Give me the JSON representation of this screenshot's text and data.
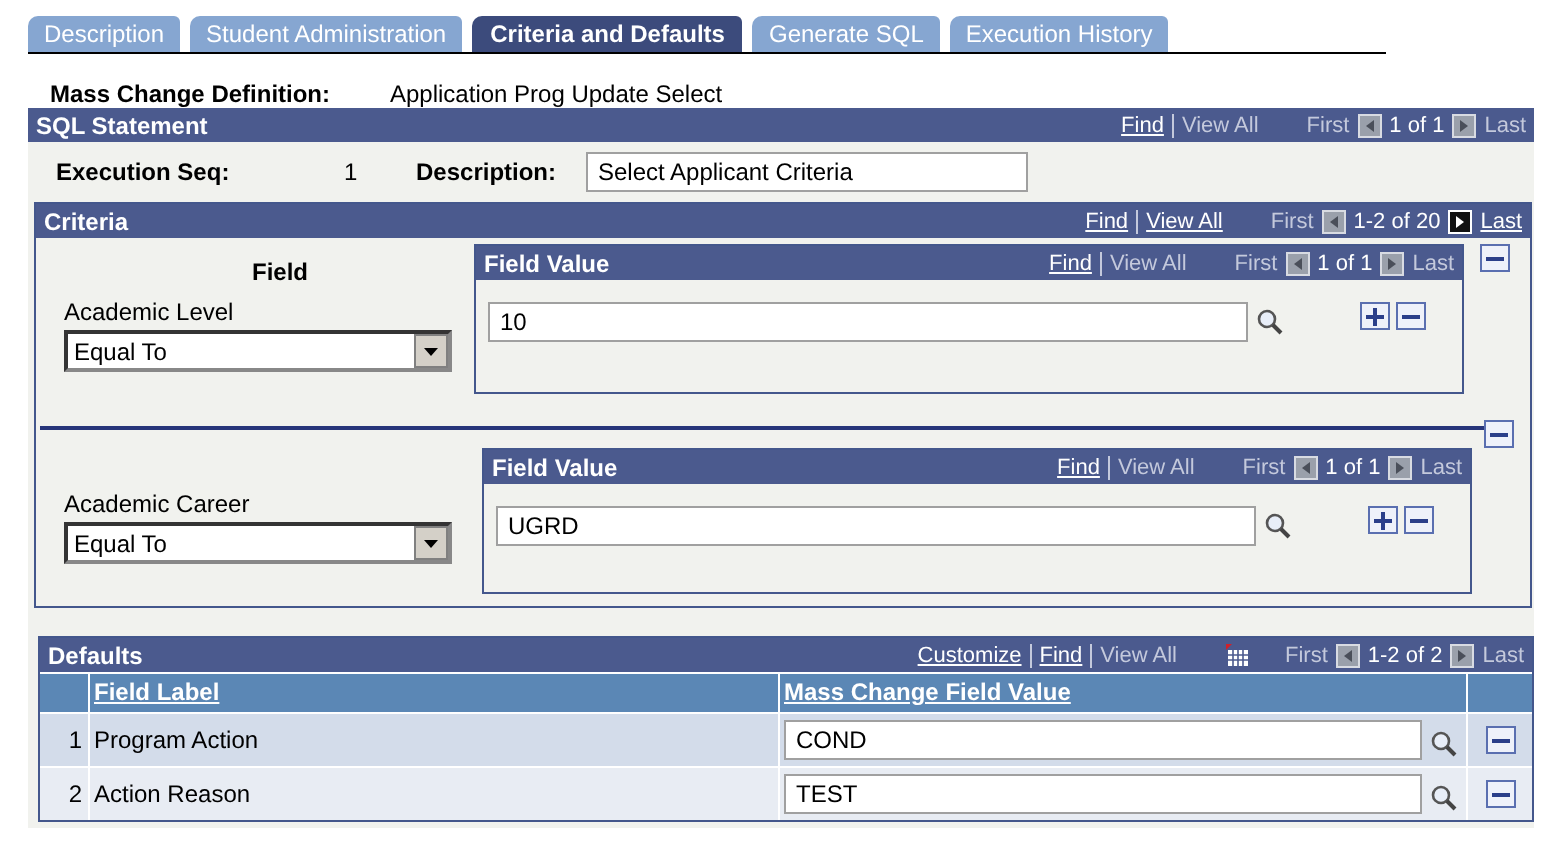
{
  "tabs": [
    {
      "label": "Description",
      "selected": false
    },
    {
      "label": "Student Administration",
      "selected": false
    },
    {
      "label": "Criteria and Defaults",
      "selected": true
    },
    {
      "label": "Generate SQL",
      "selected": false
    },
    {
      "label": "Execution History",
      "selected": false
    }
  ],
  "definition": {
    "label": "Mass Change Definition:",
    "value": "Application Prog Update Select"
  },
  "sql_statement": {
    "title": "SQL Statement",
    "nav": {
      "links": [
        {
          "label": "Find",
          "enabled": true
        },
        {
          "label": "View All",
          "enabled": false
        }
      ],
      "first": {
        "label": "First",
        "enabled": false
      },
      "prev_enabled": false,
      "count": "1 of 1",
      "next_enabled": false,
      "last": {
        "label": "Last",
        "enabled": false
      }
    },
    "seq_label": "Execution Seq:",
    "seq": "1",
    "description_label": "Description:",
    "description": "Select Applicant Criteria"
  },
  "criteria": {
    "title": "Criteria",
    "nav": {
      "links": [
        {
          "label": "Find",
          "enabled": true
        },
        {
          "label": "View All",
          "enabled": true
        }
      ],
      "first": {
        "label": "First",
        "enabled": false
      },
      "prev_enabled": false,
      "count": "1-2 of 20",
      "next_enabled": true,
      "last": {
        "label": "Last",
        "enabled": true
      }
    },
    "rows": [
      {
        "heading": "Field",
        "field": "Academic Level",
        "operator": "Equal To",
        "value_title": "Field Value",
        "nav": {
          "links": [
            {
              "label": "Find",
              "enabled": true
            },
            {
              "label": "View All",
              "enabled": false
            }
          ],
          "first": {
            "label": "First",
            "enabled": false
          },
          "prev_enabled": false,
          "count": "1 of 1",
          "next_enabled": false,
          "last": {
            "label": "Last",
            "enabled": false
          }
        },
        "value": "10"
      },
      {
        "field": "Academic Career",
        "operator": "Equal To",
        "value_title": "Field Value",
        "nav": {
          "links": [
            {
              "label": "Find",
              "enabled": true
            },
            {
              "label": "View All",
              "enabled": false
            }
          ],
          "first": {
            "label": "First",
            "enabled": false
          },
          "prev_enabled": false,
          "count": "1 of 1",
          "next_enabled": false,
          "last": {
            "label": "Last",
            "enabled": false
          }
        },
        "value": "UGRD"
      }
    ]
  },
  "defaults": {
    "title": "Defaults",
    "nav": {
      "links": [
        {
          "label": "Customize",
          "enabled": true
        },
        {
          "label": "Find",
          "enabled": true
        },
        {
          "label": "View All",
          "enabled": false
        }
      ],
      "first": {
        "label": "First",
        "enabled": false
      },
      "prev_enabled": false,
      "count": "1-2 of 2",
      "next_enabled": false,
      "last": {
        "label": "Last",
        "enabled": false
      }
    },
    "columns": [
      "Field Label",
      "Mass Change Field Value"
    ],
    "rows": [
      {
        "num": "1",
        "label": "Program Action",
        "value": "COND"
      },
      {
        "num": "2",
        "label": "Action Reason",
        "value": "TEST"
      }
    ]
  }
}
